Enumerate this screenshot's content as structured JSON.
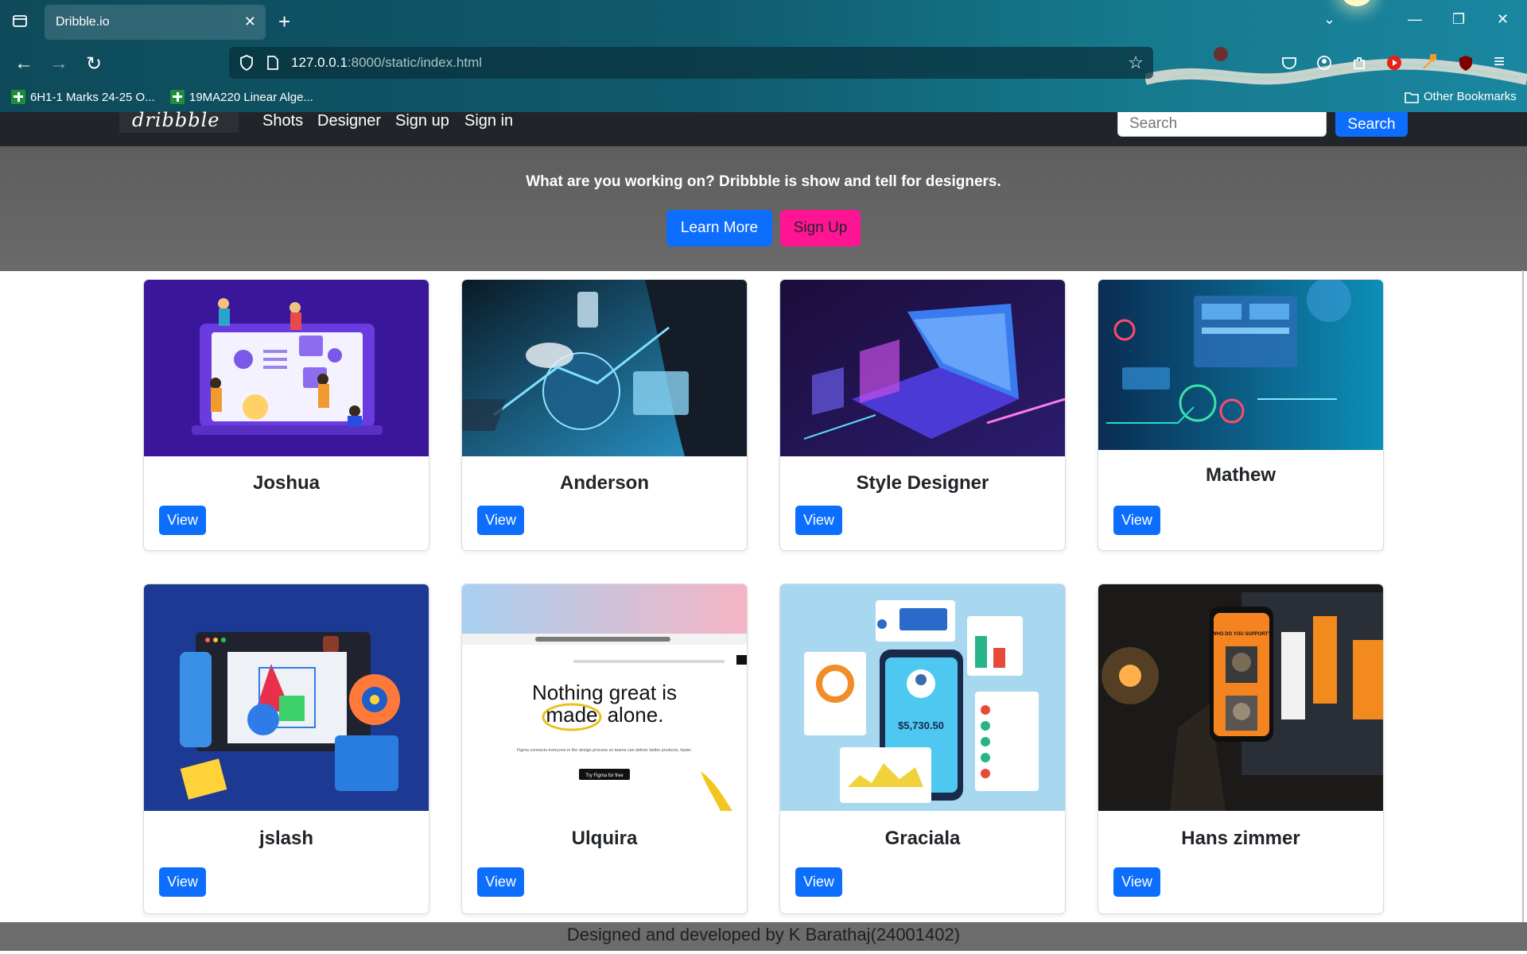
{
  "browser": {
    "tab_title": "Dribble.io",
    "url_host": "127.0.0.1",
    "url_rest": ":8000/static/index.html",
    "bookmarks": [
      "6H1-1 Marks 24-25 O...",
      "19MA220 Linear Alge..."
    ],
    "other_bookmarks": "Other Bookmarks"
  },
  "site": {
    "brand": "dribbble",
    "nav": [
      "Shots",
      "Designer",
      "Sign up",
      "Sign in"
    ],
    "search_placeholder": "Search",
    "search_button": "Search"
  },
  "hero": {
    "text": "What are you working on? Dribbble is show and tell for designers.",
    "learn_more": "Learn More",
    "sign_up": "Sign Up"
  },
  "cards": [
    {
      "title": "Joshua",
      "button": "View"
    },
    {
      "title": "Anderson",
      "button": "View"
    },
    {
      "title": "Style Designer",
      "button": "View"
    },
    {
      "title": "Mathew",
      "button": "View"
    },
    {
      "title": "jslash",
      "button": "View"
    },
    {
      "title": "Ulquira",
      "button": "View"
    },
    {
      "title": "Graciala",
      "button": "View"
    },
    {
      "title": "Hans zimmer",
      "button": "View"
    }
  ],
  "figma_card": {
    "headline_1": "Nothing great is",
    "headline_2_a": "made",
    "headline_2_b": "alone.",
    "subtext": "Figma connects everyone in the design process so teams can deliver better products, faster.",
    "cta": "Try Figma for free"
  },
  "fintech_card": {
    "amount": "$5,730.50"
  },
  "poster_card": {
    "poster_text": "WHO DO YOU SUPPORT?"
  },
  "footer": {
    "text": "Designed and developed by K Barathaj(24001402)"
  },
  "colors": {
    "primary": "#0d6efd",
    "pink": "#ff1493",
    "navbar": "#212529",
    "hero": "#666666"
  }
}
